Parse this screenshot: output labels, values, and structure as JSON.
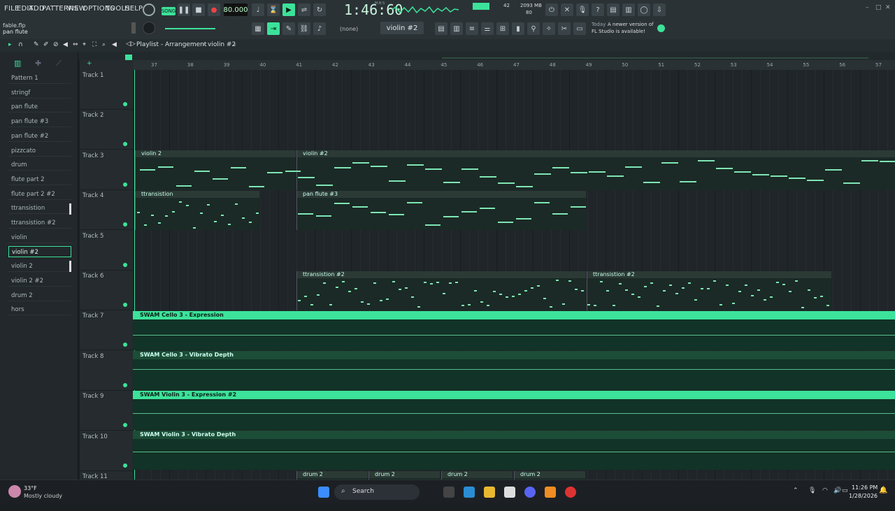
{
  "menu": [
    "FILE",
    "EDIT",
    "ADD",
    "PATTERNS",
    "VIEW",
    "OPTIONS",
    "TOOLS",
    "HELP"
  ],
  "project": {
    "file": "fable.flp",
    "pattern": "pan flute"
  },
  "transport": {
    "mode": "SONG",
    "tempo": "80.000",
    "time": "1:46:60",
    "time_unit": "M:B:S"
  },
  "monitor": {
    "cpu": "42",
    "ram": "2093 MB",
    "voices": "80"
  },
  "toolbar": {
    "pattern_none": "(none)",
    "current_pattern": "violin #2",
    "news_line1": "Today",
    "news_line2": "A newer version of",
    "news_line3": "FL Studio is available!"
  },
  "playlist": {
    "title": "Playlist - Arrangement",
    "crumb": "violin #2"
  },
  "patterns": [
    "Pattern 1",
    "stringf",
    "pan flute",
    "pan flute #3",
    "pan flute #2",
    "pizzcato",
    "drum",
    "flute part 2",
    "flute part 2 #2",
    "ttransistion",
    "ttransistion #2",
    "violin",
    "violin #2",
    "violin 2",
    "violin 2 #2",
    "drum 2",
    "hors"
  ],
  "selected_pattern_index": 12,
  "tracks": [
    "Track 1",
    "Track 2",
    "Track 3",
    "Track 4",
    "Track 5",
    "Track 6",
    "Track 7",
    "Track 8",
    "Track 9",
    "Track 10",
    "Track 11"
  ],
  "bars": [
    "37",
    "38",
    "39",
    "40",
    "41",
    "42",
    "43",
    "44",
    "45",
    "46",
    "47",
    "48",
    "49",
    "50",
    "51",
    "52",
    "53",
    "54",
    "55",
    "56",
    "57"
  ],
  "clips": {
    "t3a": "violin 2",
    "t3b": "violin #2",
    "t4a": "ttransistion",
    "t4b": "pan flute #3",
    "t6a": "ttransistion #2",
    "t6b": "ttransistion #2",
    "t7": "SWAM Cello 3 - Expression",
    "t8": "SWAM Cello 3 - Vibrato Depth",
    "t9": "SWAM Violin 3 - Expression #2",
    "t10": "SWAM Violin 3 - Vibrato Depth",
    "t11": "drum 2"
  },
  "weather": {
    "temp": "33°F",
    "desc": "Mostly cloudy"
  },
  "taskbar": {
    "search": "Search",
    "clock": "11:26 PM",
    "date": "1/28/2026"
  },
  "colors": {
    "accent": "#3ce29a",
    "bg": "#1f2528"
  }
}
